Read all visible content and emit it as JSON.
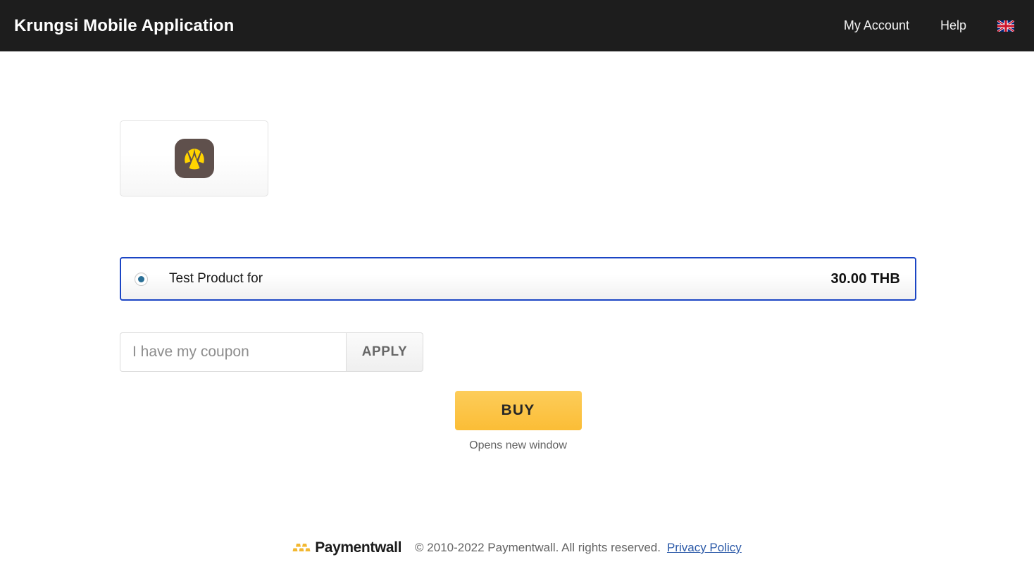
{
  "header": {
    "brand_title": "Krungsi Mobile Application",
    "nav": [
      {
        "label": "My Account",
        "name": "nav-my-account"
      },
      {
        "label": "Help",
        "name": "nav-help"
      }
    ],
    "language_flag": "uk-flag-icon"
  },
  "merchant": {
    "app_icon_name": "krungsri-app-icon",
    "icon_bg_color": "#5f504c",
    "icon_fg_color": "#ffd400"
  },
  "product": {
    "selected": true,
    "name": "Test Product for",
    "price": "30.00 THB",
    "border_color": "#1b45c4",
    "radio_color": "#2a6f96"
  },
  "coupon": {
    "placeholder": "I have my coupon",
    "value": "",
    "apply_label": "APPLY"
  },
  "buy": {
    "label": "BUY",
    "note": "Opens new window",
    "color": "#fbbd36"
  },
  "footer": {
    "logo_word": "Paymentwall",
    "copyright": "© 2010-2022 Paymentwall. All rights reserved.",
    "privacy_label": "Privacy Policy",
    "link_color": "#2c5aa8"
  }
}
